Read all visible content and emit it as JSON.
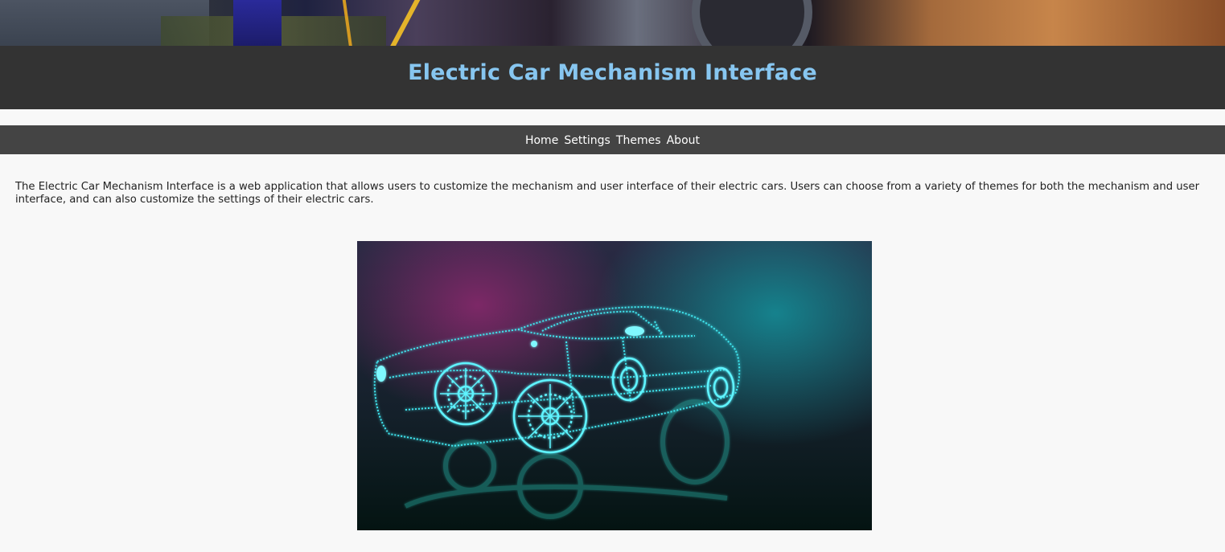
{
  "page": {
    "title": "Electric Car Mechanism Interface"
  },
  "nav": {
    "items": [
      "Home",
      "Settings",
      "Themes",
      "About"
    ]
  },
  "intro": {
    "text": "The Electric Car Mechanism Interface is a web application that allows users to customize the mechanism and user interface of their electric cars. Users can choose from a variety of themes for both the mechanism and user interface, and can also customize the settings of their electric cars."
  },
  "colors": {
    "title": "#87c6f0",
    "header_bg": "#333333",
    "nav_bg": "#444444",
    "page_bg": "#f8f8f8",
    "hologram": "#3fe6ef"
  },
  "images": {
    "banner": "ev-charging-banner",
    "hero": "holographic-car-wireframe"
  }
}
